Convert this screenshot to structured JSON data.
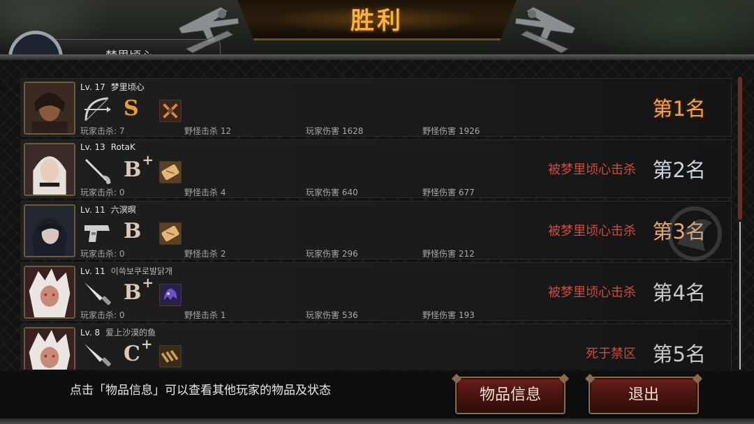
{
  "header": {
    "title": "胜利",
    "player_plate_name": "梦里顷心"
  },
  "rows": [
    {
      "level": "Lv. 17",
      "name": "梦里顷心",
      "weapon": "bow-icon",
      "grade": "S",
      "grade_plus": "",
      "status": "",
      "rank": "第1名",
      "stats": {
        "player_kills": "玩家击杀: 7",
        "monster_kills": "野怪击杀 12",
        "player_damage": "玩家伤害 1628",
        "monster_damage": "野怪伤害 1926"
      }
    },
    {
      "level": "Lv. 13",
      "name": "RotaK",
      "weapon": "rapier-icon",
      "grade": "B",
      "grade_plus": "+",
      "status": "被梦里顷心击杀",
      "rank": "第2名",
      "stats": {
        "player_kills": "玩家击杀: 0",
        "monster_kills": "野怪击杀 4",
        "player_damage": "玩家伤害 640",
        "monster_damage": "野怪伤害 677"
      }
    },
    {
      "level": "Lv. 11",
      "name": "六溟暝",
      "weapon": "pistol-icon",
      "grade": "B",
      "grade_plus": "",
      "status": "被梦里顷心击杀",
      "rank": "第3名",
      "stats": {
        "player_kills": "玩家击杀: 0",
        "monster_kills": "野怪击杀 2",
        "player_damage": "玩家伤害 296",
        "monster_damage": "野怪伤害 212"
      }
    },
    {
      "level": "Lv. 11",
      "name": "이쓱보쿠로발닭개",
      "weapon": "knife-icon",
      "grade": "B",
      "grade_plus": "+",
      "status": "被梦里顷心击杀",
      "rank": "第4名",
      "stats": {
        "player_kills": "玩家击杀: 0",
        "monster_kills": "野怪击杀 1",
        "player_damage": "玩家伤害 536",
        "monster_damage": "野怪伤害 193"
      }
    },
    {
      "level": "Lv. 8",
      "name": "爱上沙漠的鱼",
      "weapon": "knife-icon",
      "grade": "C",
      "grade_plus": "+",
      "status": "死于禁区",
      "rank": "第5名",
      "stats": {
        "player_kills": "",
        "monster_kills": "",
        "player_damage": "",
        "monster_damage": ""
      }
    }
  ],
  "footer": {
    "hint": "点击「物品信息」可以查看其他玩家的物品及状态",
    "items_button": "物品信息",
    "exit_button": "退出"
  },
  "colors": {
    "title_gold": "#f3b14a",
    "status_red": "#d24a3a",
    "button_red": "#6a1f18"
  },
  "scroll": {
    "position_fraction": 0.0,
    "visible_fraction": 0.49
  }
}
